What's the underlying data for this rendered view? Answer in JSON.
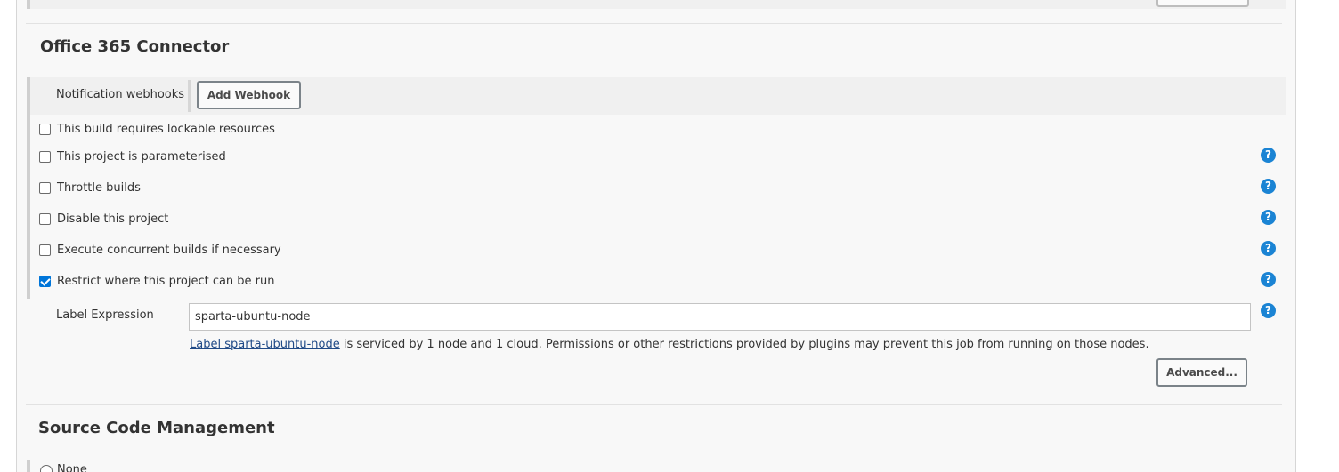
{
  "office365": {
    "title": "Office 365 Connector",
    "webhooks_label": "Notification webhooks",
    "add_webhook_button": "Add Webhook"
  },
  "options": [
    {
      "label": "This build requires lockable resources",
      "checked": false,
      "help": false
    },
    {
      "label": "This project is parameterised",
      "checked": false,
      "help": true
    },
    {
      "label": "Throttle builds",
      "checked": false,
      "help": true
    },
    {
      "label": "Disable this project",
      "checked": false,
      "help": true
    },
    {
      "label": "Execute concurrent builds if necessary",
      "checked": false,
      "help": true
    },
    {
      "label": "Restrict where this project can be run",
      "checked": true,
      "help": true
    }
  ],
  "restrict": {
    "label_expression_label": "Label Expression",
    "label_expression_value": "sparta-ubuntu-node",
    "info_link": "Label sparta-ubuntu-node",
    "info_text": " is serviced by 1 node and 1 cloud. Permissions or other restrictions provided by plugins may prevent this job from running on those nodes.",
    "advanced_button": "Advanced..."
  },
  "scm": {
    "title": "Source Code Management",
    "first_option": "None"
  },
  "help_glyph": "?",
  "help_icon": "question-circle-icon",
  "colors": {
    "accent": "#1b84d4",
    "checkbox_checked": "#0075d9",
    "link": "#204a87"
  }
}
